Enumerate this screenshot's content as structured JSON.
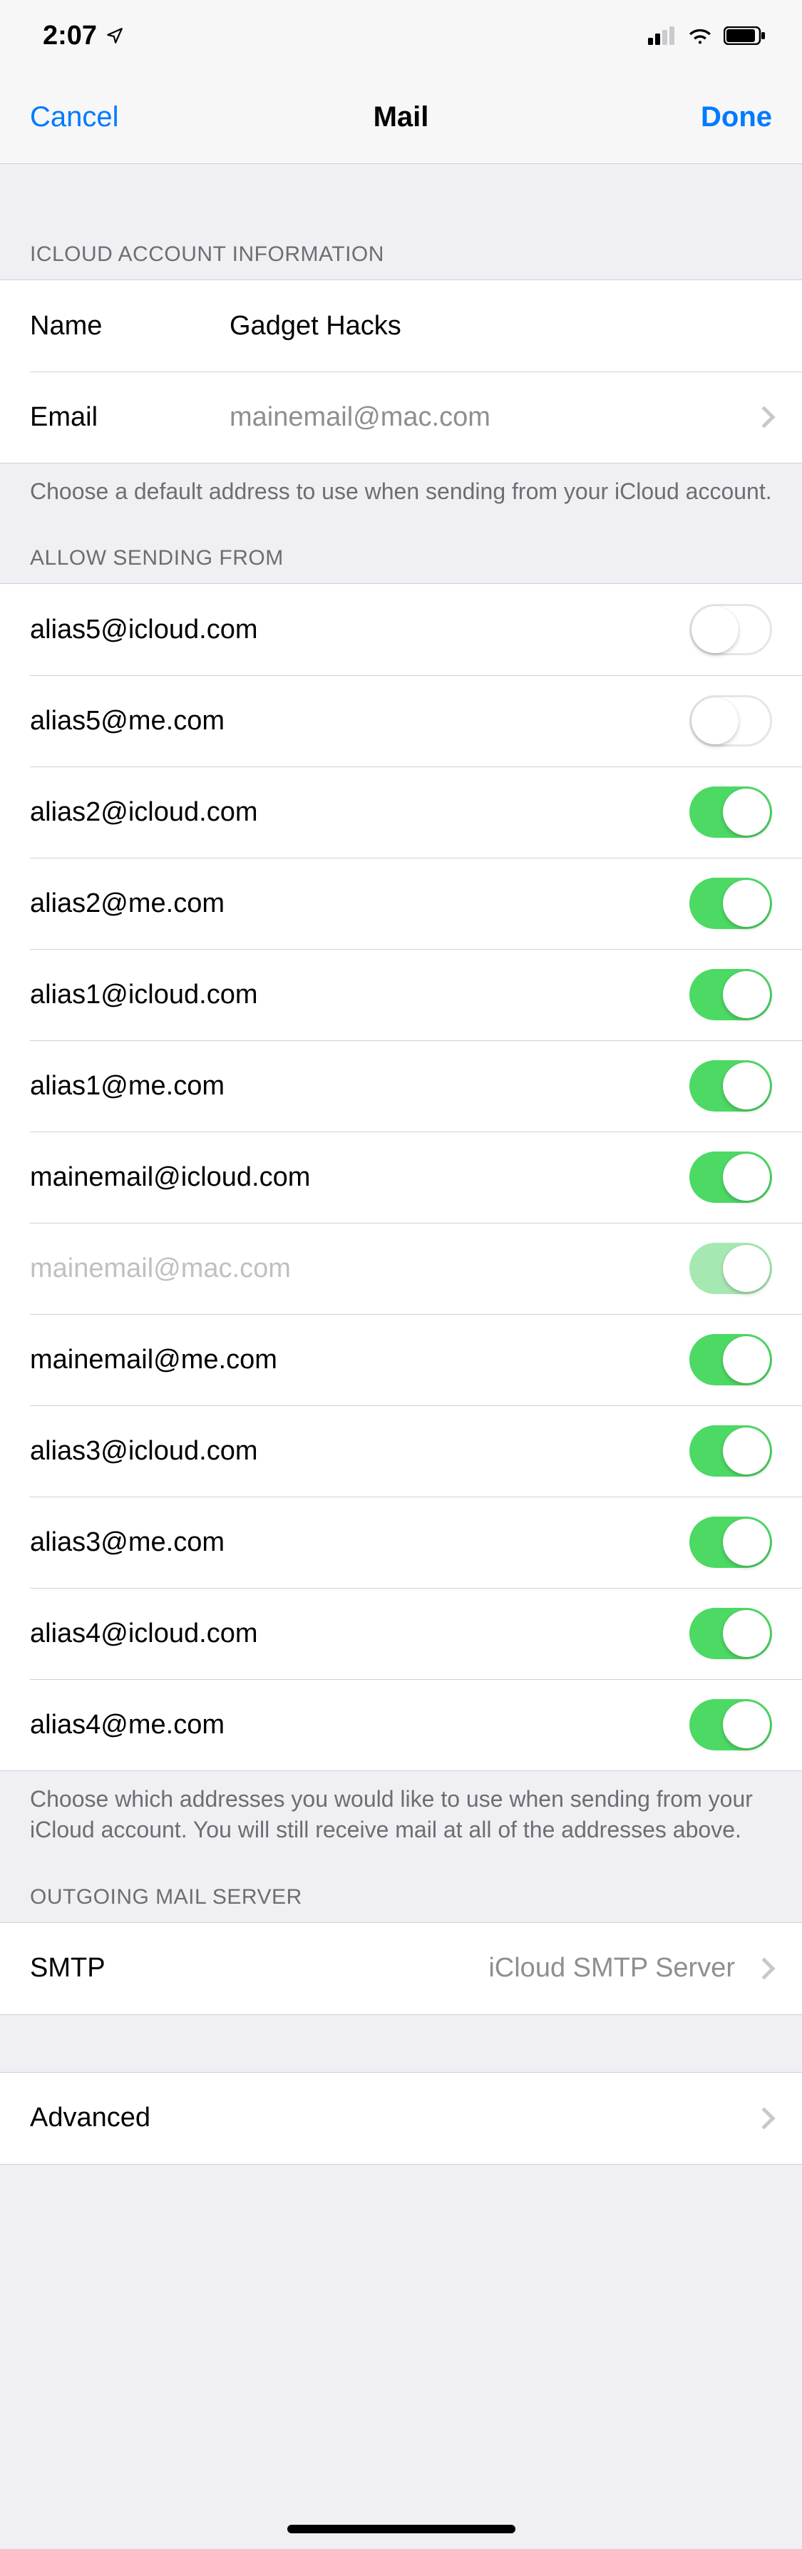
{
  "status": {
    "time": "2:07"
  },
  "nav": {
    "left": "Cancel",
    "title": "Mail",
    "right": "Done"
  },
  "sections": {
    "account_info": {
      "header": "ICLOUD ACCOUNT INFORMATION",
      "name_label": "Name",
      "name_value": "Gadget Hacks",
      "email_label": "Email",
      "email_value": "mainemail@mac.com",
      "footer": "Choose a default address to use when sending from your iCloud account."
    },
    "allow_sending": {
      "header": "ALLOW SENDING FROM",
      "items": [
        {
          "address": "alias5@icloud.com",
          "on": false,
          "locked": false
        },
        {
          "address": "alias5@me.com",
          "on": false,
          "locked": false
        },
        {
          "address": "alias2@icloud.com",
          "on": true,
          "locked": false
        },
        {
          "address": "alias2@me.com",
          "on": true,
          "locked": false
        },
        {
          "address": "alias1@icloud.com",
          "on": true,
          "locked": false
        },
        {
          "address": "alias1@me.com",
          "on": true,
          "locked": false
        },
        {
          "address": "mainemail@icloud.com",
          "on": true,
          "locked": false
        },
        {
          "address": "mainemail@mac.com",
          "on": true,
          "locked": true
        },
        {
          "address": "mainemail@me.com",
          "on": true,
          "locked": false
        },
        {
          "address": "alias3@icloud.com",
          "on": true,
          "locked": false
        },
        {
          "address": "alias3@me.com",
          "on": true,
          "locked": false
        },
        {
          "address": "alias4@icloud.com",
          "on": true,
          "locked": false
        },
        {
          "address": "alias4@me.com",
          "on": true,
          "locked": false
        }
      ],
      "footer": "Choose which addresses you would like to use when sending from your iCloud account. You will still receive mail at all of the addresses above."
    },
    "outgoing": {
      "header": "OUTGOING MAIL SERVER",
      "label": "SMTP",
      "value": "iCloud SMTP Server"
    },
    "advanced": {
      "label": "Advanced"
    }
  }
}
